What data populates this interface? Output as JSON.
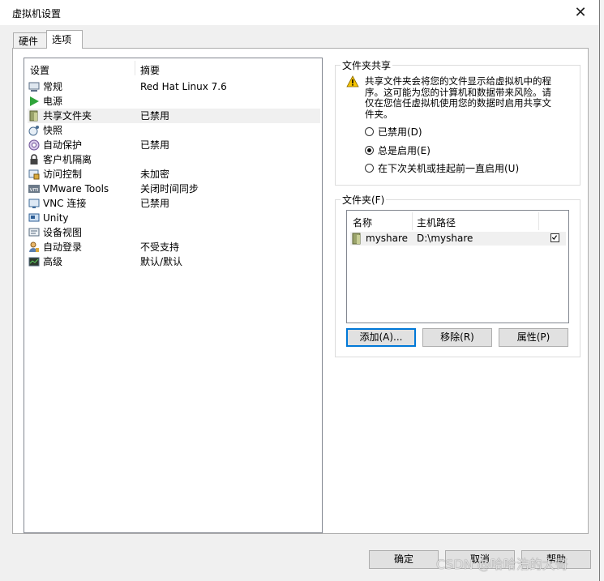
{
  "window": {
    "title": "虚拟机设置"
  },
  "tabs": [
    {
      "label": "硬件"
    },
    {
      "label": "选项"
    }
  ],
  "settings_list": {
    "headers": {
      "setting": "设置",
      "summary": "摘要"
    },
    "items": [
      {
        "name": "常规",
        "summary": "Red Hat Linux 7.6",
        "icon": "general-icon"
      },
      {
        "name": "电源",
        "summary": "",
        "icon": "power-icon"
      },
      {
        "name": "共享文件夹",
        "summary": "已禁用",
        "icon": "shared-folder-icon"
      },
      {
        "name": "快照",
        "summary": "",
        "icon": "snapshot-icon"
      },
      {
        "name": "自动保护",
        "summary": "已禁用",
        "icon": "autoprotect-icon"
      },
      {
        "name": "客户机隔离",
        "summary": "",
        "icon": "lock-icon"
      },
      {
        "name": "访问控制",
        "summary": "未加密",
        "icon": "access-control-icon"
      },
      {
        "name": "VMware Tools",
        "summary": "关闭时间同步",
        "icon": "vmware-tools-icon"
      },
      {
        "name": "VNC 连接",
        "summary": "已禁用",
        "icon": "vnc-icon"
      },
      {
        "name": "Unity",
        "summary": "",
        "icon": "unity-icon"
      },
      {
        "name": "设备视图",
        "summary": "",
        "icon": "device-view-icon"
      },
      {
        "name": "自动登录",
        "summary": "不受支持",
        "icon": "autologin-icon"
      },
      {
        "name": "高级",
        "summary": "默认/默认",
        "icon": "advanced-icon"
      }
    ]
  },
  "folder_sharing": {
    "legend": "文件夹共享",
    "warning": "共享文件夹会将您的文件显示给虚拟机中的程序。这可能为您的计算机和数据带来风险。请仅在您信任虚拟机使用您的数据时启用共享文件夹。",
    "options": [
      {
        "label": "已禁用(D)",
        "selected": false
      },
      {
        "label": "总是启用(E)",
        "selected": true
      },
      {
        "label": "在下次关机或挂起前一直启用(U)",
        "selected": false
      }
    ]
  },
  "folders": {
    "legend": "文件夹(F)",
    "headers": {
      "name": "名称",
      "host_path": "主机路径"
    },
    "rows": [
      {
        "name": "myshare",
        "path": "D:\\myshare",
        "enabled": true
      }
    ],
    "buttons": {
      "add": "添加(A)...",
      "remove": "移除(R)",
      "properties": "属性(P)"
    }
  },
  "footer": {
    "ok": "确定",
    "cancel": "取消",
    "help": "帮助"
  },
  "watermark": "CSDN @哈哈浩的大哥"
}
